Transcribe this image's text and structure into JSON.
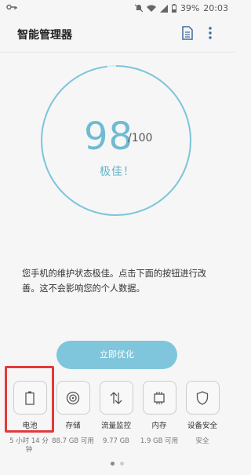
{
  "status_bar": {
    "battery": "39%",
    "time": "20:03",
    "icons": [
      "key-icon",
      "mute-icon",
      "wifi-icon",
      "signal-icon",
      "battery-icon"
    ]
  },
  "header": {
    "title": "智能管理器",
    "actions": [
      "document-icon",
      "more-vert-icon"
    ]
  },
  "score": {
    "value": "98",
    "max": "/100",
    "level": 0.98,
    "rating": "极佳！"
  },
  "message": "您手机的维护状态极佳。点击下面的按钮进行改善。这不会影响您的个人数据。",
  "optimize_button": "立即优化",
  "tiles": [
    {
      "label": "电池",
      "value": "5 小时 14 分钟",
      "icon": "battery-icon"
    },
    {
      "label": "存储",
      "value": "88.7 GB 可用",
      "icon": "storage-icon"
    },
    {
      "label": "流量监控",
      "value": "9.77 GB",
      "icon": "data-usage-icon"
    },
    {
      "label": "内存",
      "value": "1.9 GB 可用",
      "icon": "memory-chip-icon"
    },
    {
      "label": "设备安全",
      "value": "安全",
      "icon": "shield-icon"
    }
  ],
  "colors": {
    "accent": "#6fbbd2",
    "button": "#7fc6dc",
    "highlight": "#e13a3a",
    "ring": "#7ec5da"
  },
  "pager": {
    "count": 2,
    "active": 1
  }
}
